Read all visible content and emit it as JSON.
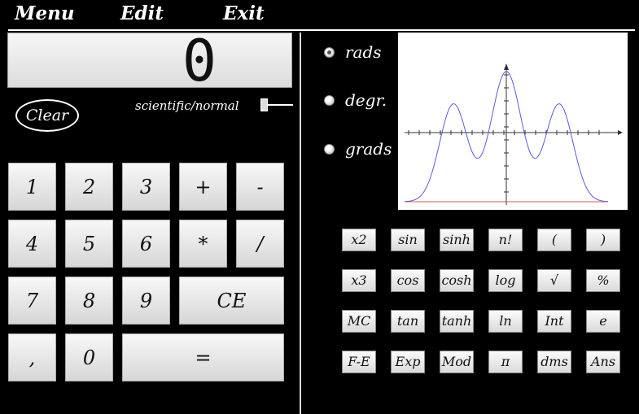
{
  "menu": {
    "items": [
      "Menu",
      "Edit",
      "Exit"
    ]
  },
  "display": {
    "value": "0"
  },
  "controls": {
    "clear_label": "Clear",
    "mode_label": "scientific/normal"
  },
  "keypad": {
    "keys": [
      "1",
      "2",
      "3",
      "+",
      "-",
      "4",
      "5",
      "6",
      "*",
      "/",
      "7",
      "8",
      "9",
      "CE",
      ",",
      "0",
      "="
    ]
  },
  "angle_modes": {
    "options": [
      "rads",
      "degr.",
      "grads"
    ],
    "selected": "rads"
  },
  "scientific": {
    "keys": [
      "x2",
      "sin",
      "sinh",
      "n!",
      "(",
      ")",
      "x3",
      "cos",
      "cosh",
      "log",
      "√",
      "%",
      "MC",
      "tan",
      "tanh",
      "ln",
      "Int",
      "e",
      "F-E",
      "Exp",
      "Mod",
      "π",
      "dms",
      "Ans"
    ]
  },
  "graph": {
    "curve_color": "#5a5ae0",
    "baseline_color": "#e05050"
  }
}
